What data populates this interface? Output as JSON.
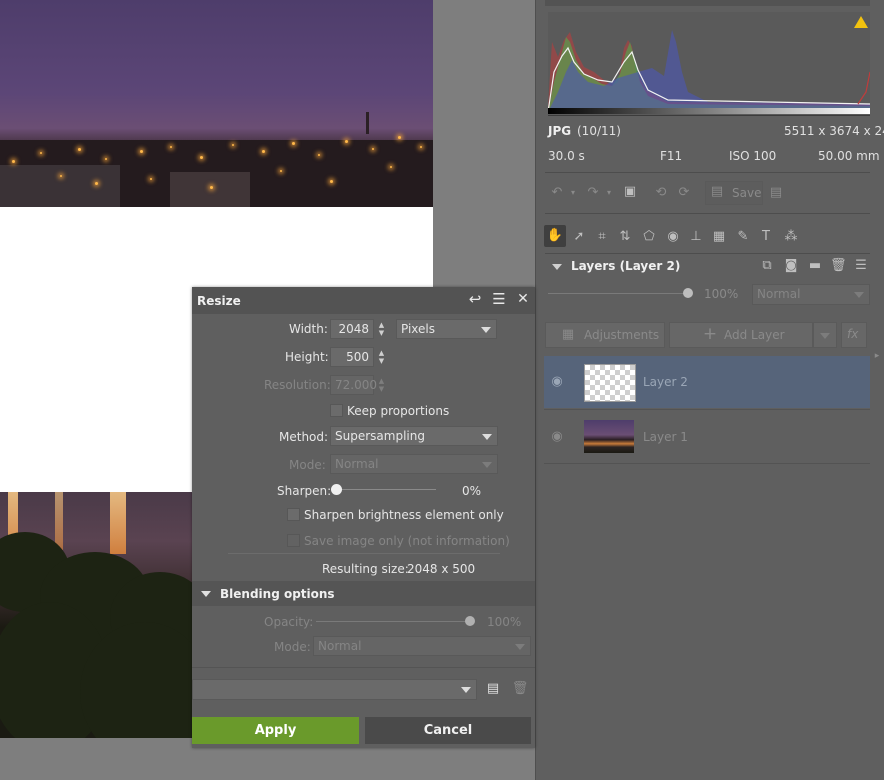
{
  "histogram": {
    "format": "JPG",
    "index": "(10/11)",
    "dimensions": "5511 x 3674 x 24",
    "warning_icon": "warning-triangle-icon"
  },
  "exif": {
    "shutter": "30.0 s",
    "aperture": "F11",
    "iso": "ISO 100",
    "focal": "50.00 mm"
  },
  "toolbar": {
    "save_label": "Save"
  },
  "layers": {
    "title": "Layers (Layer 2)",
    "opacity": "100%",
    "blend_mode": "Normal",
    "adjustments_label": "Adjustments",
    "add_layer_label": "Add Layer",
    "fx_label": "fx",
    "items": [
      {
        "name": "Layer 2",
        "selected": true
      },
      {
        "name": "Layer 1",
        "selected": false
      }
    ]
  },
  "resize": {
    "title": "Resize",
    "width_label": "Width:",
    "width_value": "2048",
    "unit": "Pixels",
    "height_label": "Height:",
    "height_value": "500",
    "resolution_label": "Resolution:",
    "resolution_value": "72.000",
    "keep_proportions_label": "Keep proportions",
    "method_label": "Method:",
    "method_value": "Supersampling",
    "mode_label": "Mode:",
    "mode_value": "Normal",
    "sharpen_label": "Sharpen:",
    "sharpen_value": "0%",
    "sharpen_level": 0,
    "sharpen_brightness_label": "Sharpen brightness element only",
    "save_image_only_label": "Save image only (not information)",
    "resulting_size_label": "Resulting size:",
    "resulting_size_value": "2048 x 500",
    "blending_title": "Blending options",
    "opacity_label": "Opacity:",
    "opacity_value": "100%",
    "blend_mode_label": "Mode:",
    "blend_mode_value": "Normal",
    "apply_label": "Apply",
    "cancel_label": "Cancel"
  },
  "colors": {
    "apply": "#6a9a2b",
    "selected_layer": "#56647a",
    "warning": "#f2c20f"
  }
}
